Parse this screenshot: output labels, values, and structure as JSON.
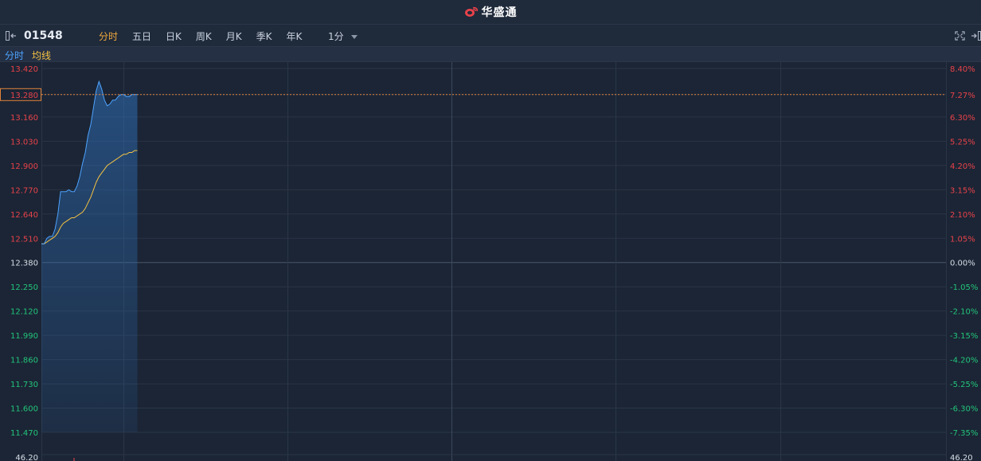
{
  "brand": {
    "name": "华盛通"
  },
  "toolbar": {
    "code": "01548",
    "tabs": [
      {
        "label": "分时",
        "active": true
      },
      {
        "label": "五日",
        "active": false
      },
      {
        "label": "日K",
        "active": false
      },
      {
        "label": "周K",
        "active": false
      },
      {
        "label": "月K",
        "active": false
      },
      {
        "label": "季K",
        "active": false
      },
      {
        "label": "年K",
        "active": false
      }
    ],
    "interval": "1分"
  },
  "legend": {
    "minute_label": "分时",
    "avg_label": "均线"
  },
  "colors": {
    "up": "#e8424a",
    "down": "#22c47a",
    "neutral": "#d6dde6",
    "price_line": "#4da3ff",
    "avg_line": "#f5c242",
    "current_price": "#e0823a",
    "accent": "#f0a93a"
  },
  "chart_data": {
    "type": "line",
    "ylim": [
      11.47,
      13.42
    ],
    "prev_close": 12.38,
    "current_price": 13.28,
    "current_change": "7.27%",
    "price_ticks": [
      "13.420",
      "13.280",
      "13.160",
      "13.030",
      "12.900",
      "12.770",
      "12.640",
      "12.510",
      "12.380",
      "12.250",
      "12.120",
      "11.990",
      "11.860",
      "11.730",
      "11.600",
      "11.470"
    ],
    "pct_ticks": [
      "8.40%",
      "7.27%",
      "6.30%",
      "5.25%",
      "4.20%",
      "3.15%",
      "2.10%",
      "1.05%",
      "0.00%",
      "-1.05%",
      "-2.10%",
      "-3.15%",
      "-4.20%",
      "-5.25%",
      "-6.30%",
      "-7.35%"
    ],
    "volume_label": "46.20",
    "grid": true,
    "total_minutes": 330,
    "series": [
      {
        "name": "分时",
        "x": [
          0,
          1,
          2,
          3,
          4,
          5,
          6,
          7,
          8,
          9,
          10,
          11,
          12,
          13,
          14,
          15,
          16,
          17,
          18,
          19,
          20,
          21,
          22,
          23,
          24,
          25,
          26,
          27,
          28,
          29,
          30,
          31,
          32,
          33,
          34,
          35
        ],
        "values": [
          12.48,
          12.48,
          12.51,
          12.52,
          12.52,
          12.56,
          12.64,
          12.76,
          12.76,
          12.76,
          12.77,
          12.76,
          12.76,
          12.79,
          12.84,
          12.91,
          12.97,
          13.06,
          13.12,
          13.21,
          13.3,
          13.35,
          13.31,
          13.25,
          13.22,
          13.23,
          13.25,
          13.25,
          13.27,
          13.28,
          13.28,
          13.27,
          13.27,
          13.28,
          13.28,
          13.28
        ]
      },
      {
        "name": "均线",
        "x": [
          0,
          1,
          2,
          3,
          4,
          5,
          6,
          7,
          8,
          9,
          10,
          11,
          12,
          13,
          14,
          15,
          16,
          17,
          18,
          19,
          20,
          21,
          22,
          23,
          24,
          25,
          26,
          27,
          28,
          29,
          30,
          31,
          32,
          33,
          34,
          35
        ],
        "values": [
          12.48,
          12.48,
          12.49,
          12.5,
          12.51,
          12.52,
          12.54,
          12.57,
          12.59,
          12.6,
          12.61,
          12.62,
          12.62,
          12.63,
          12.64,
          12.65,
          12.67,
          12.7,
          12.73,
          12.77,
          12.81,
          12.84,
          12.86,
          12.88,
          12.9,
          12.91,
          12.92,
          12.93,
          12.94,
          12.95,
          12.96,
          12.96,
          12.97,
          12.97,
          12.98,
          12.98
        ]
      }
    ]
  }
}
